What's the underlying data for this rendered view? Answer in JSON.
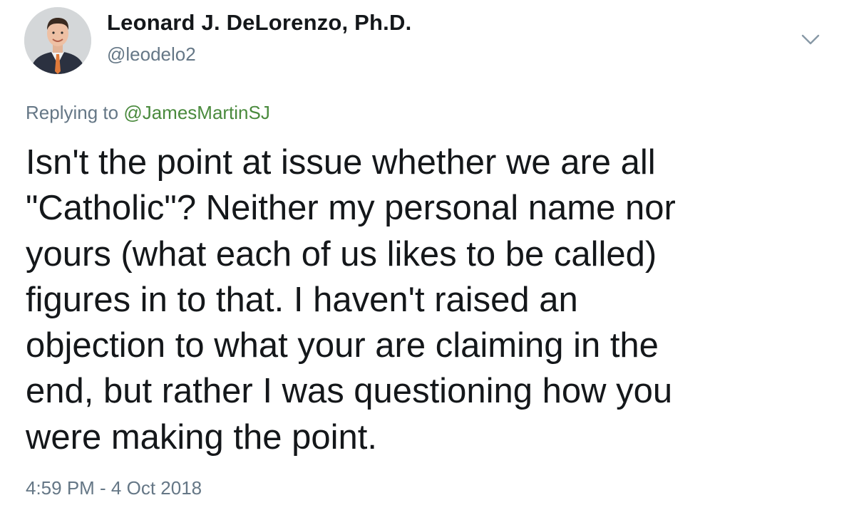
{
  "author": {
    "display_name": "Leonard J. DeLorenzo, Ph.D.",
    "handle": "@leodelo2"
  },
  "reply": {
    "prefix": "Replying to",
    "mention": "@JamesMartinSJ"
  },
  "tweet": {
    "lines": [
      "Isn't the point at issue whether we are all",
      "\"Catholic\"? Neither my personal name nor",
      "yours (what each of us likes to be called)",
      "figures in to that. I haven't raised an",
      "objection to what your are claiming in the",
      "end, but rather I was questioning how you",
      "were making the point."
    ],
    "timestamp": "4:59 PM - 4 Oct 2018"
  },
  "icons": {
    "avatar": "profile-photo",
    "caret": "chevron-down-icon"
  },
  "colors": {
    "text": "#14171a",
    "secondary": "#657786",
    "mention": "#4a8a3d"
  }
}
